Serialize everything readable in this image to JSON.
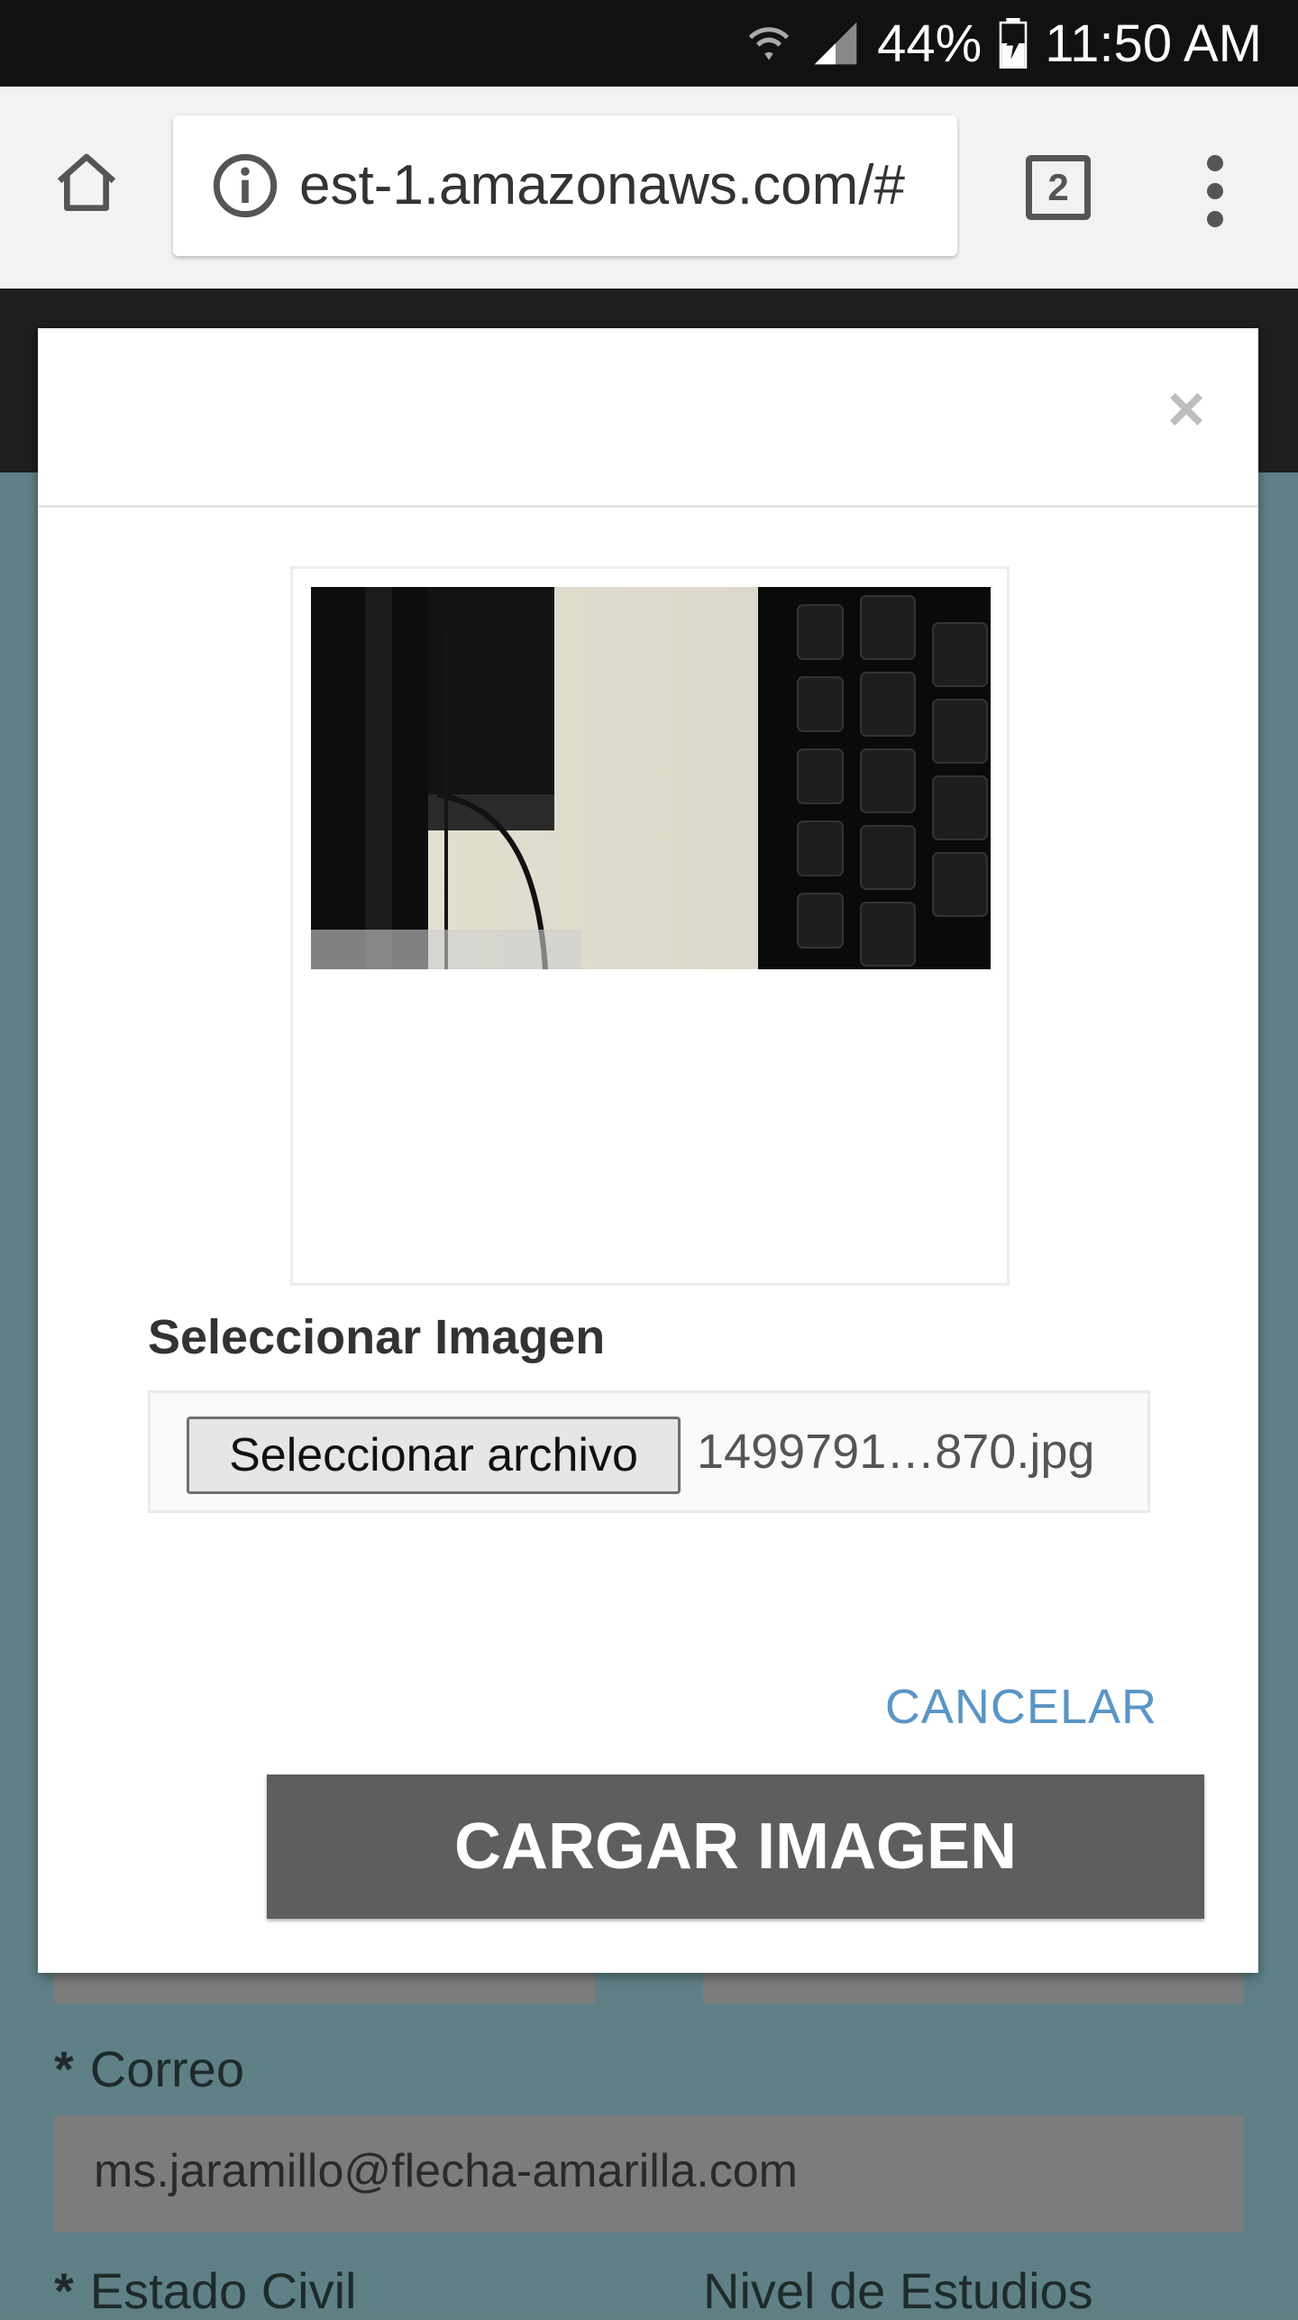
{
  "status_bar": {
    "battery": "44%",
    "time": "11:50 AM"
  },
  "browser": {
    "url": "est-1.amazonaws.com/#",
    "tab_count": "2"
  },
  "modal": {
    "close_symbol": "×",
    "select_label": "Seleccionar Imagen",
    "file_button_label": "Seleccionar archivo",
    "file_name": "1499791…870.jpg",
    "cancel_label": "CANCELAR",
    "upload_label": "CARGAR IMAGEN"
  },
  "background_form": {
    "email_label": "Correo",
    "email_value": "ms.jaramillo@flecha-amarilla.com",
    "marital_label": "Estado Civil",
    "education_label": "Nivel de Estudios",
    "required_marker": "*"
  },
  "icons": [
    "wifi-icon",
    "signal-icon",
    "battery-icon",
    "home-icon",
    "info-icon",
    "tabs-icon",
    "more-vert-icon",
    "close-icon"
  ]
}
